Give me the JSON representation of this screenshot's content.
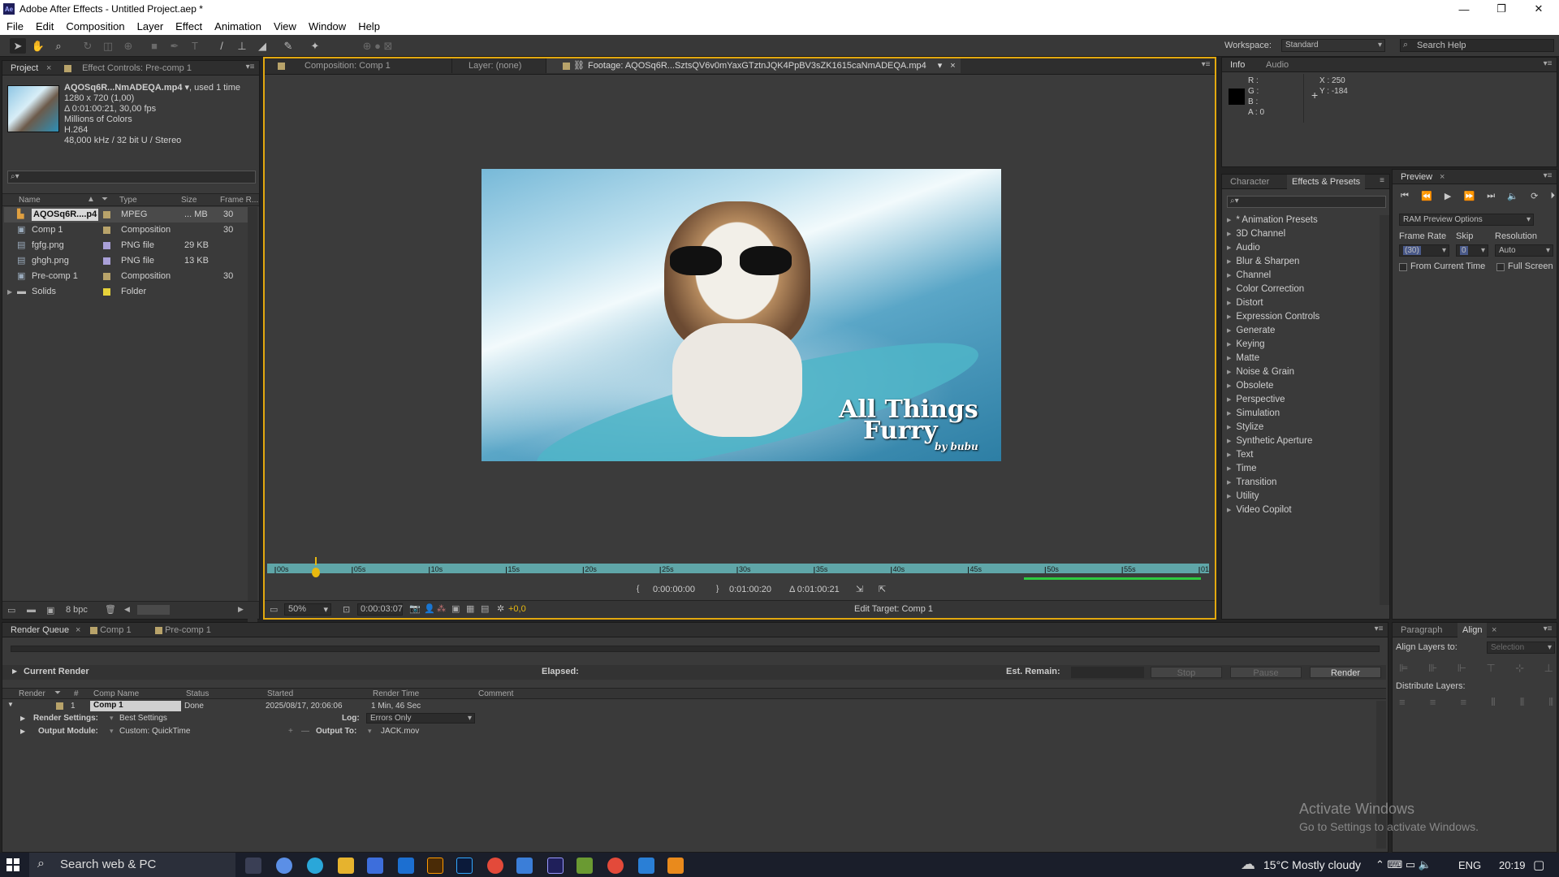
{
  "window": {
    "title": "Adobe After Effects - Untitled Project.aep *",
    "logo": "Ae",
    "minimize": "—",
    "maximize": "❐",
    "close": "✕"
  },
  "menu": [
    "File",
    "Edit",
    "Composition",
    "Layer",
    "Effect",
    "Animation",
    "View",
    "Window",
    "Help"
  ],
  "workspace": {
    "label": "Workspace:",
    "value": "Standard",
    "search_placeholder": "Search Help"
  },
  "project": {
    "tabs": [
      "Project",
      "Effect Controls: Pre-comp 1"
    ],
    "info": {
      "name": "AQOSq6R...NmADEQA.mp4 ▾",
      "used": ", used 1 time",
      "dims": "1280 x 720 (1,00)",
      "duration": "Δ 0:01:00:21, 30,00 fps",
      "colors": "Millions of Colors",
      "codec": "H.264",
      "audio": "48,000 kHz / 32 bit U / Stereo"
    },
    "search_placeholder": "⌕▾",
    "columns": [
      "Name",
      "Type",
      "Size",
      "Frame R..."
    ],
    "items": [
      {
        "name": "AQOSq6R....p4",
        "type": "MPEG",
        "size": "... MB",
        "fps": "30",
        "color": "#b8a36a",
        "icon": "footage-icon"
      },
      {
        "name": "Comp 1",
        "type": "Composition",
        "size": "",
        "fps": "30",
        "color": "#b8a36a",
        "icon": "composition-icon"
      },
      {
        "name": "fgfg.png",
        "type": "PNG file",
        "size": "29 KB",
        "fps": "",
        "color": "#a9a0d8",
        "icon": "image-icon"
      },
      {
        "name": "ghgh.png",
        "type": "PNG file",
        "size": "13 KB",
        "fps": "",
        "color": "#a9a0d8",
        "icon": "image-icon"
      },
      {
        "name": "Pre-comp 1",
        "type": "Composition",
        "size": "",
        "fps": "30",
        "color": "#b8a36a",
        "icon": "composition-icon"
      },
      {
        "name": "Solids",
        "type": "Folder",
        "size": "",
        "fps": "",
        "color": "#e6d23a",
        "icon": "folder-icon"
      }
    ],
    "bpc": "8 bpc"
  },
  "viewer": {
    "tabs": [
      "Composition: Comp 1",
      "Layer: (none)",
      "Footage: AQOSq6R...SztsQV6v0mYaxGTztnJQK4PpBV3sZK1615caNmADEQA.mp4"
    ],
    "watermark_line1": "All Things",
    "watermark_line2": "Furry",
    "watermark_line3": "by bubu",
    "ruler": [
      "00s",
      "05s",
      "10s",
      "15s",
      "20s",
      "25s",
      "30s",
      "35s",
      "40s",
      "45s",
      "50s",
      "55s",
      "01:00s"
    ],
    "in_point": "0:00:00:00",
    "out_point": "0:01:00:20",
    "duration": "Δ 0:01:00:21",
    "zoom": "50%",
    "timecode": "0:00:03:07",
    "exposure": "+0,0",
    "edit_target": "Edit Target: Comp 1"
  },
  "info": {
    "tabs": [
      "Info",
      "Audio"
    ],
    "r": "R :",
    "g": "G :",
    "b": "B :",
    "a": "A : 0",
    "x": "X : 250",
    "y": "Y : -184"
  },
  "effects": {
    "tabs": [
      "Character",
      "Effects & Presets"
    ],
    "items": [
      "* Animation Presets",
      "3D Channel",
      "Audio",
      "Blur & Sharpen",
      "Channel",
      "Color Correction",
      "Distort",
      "Expression Controls",
      "Generate",
      "Keying",
      "Matte",
      "Noise & Grain",
      "Obsolete",
      "Perspective",
      "Simulation",
      "Stylize",
      "Synthetic Aperture",
      "Text",
      "Time",
      "Transition",
      "Utility",
      "Video Copilot"
    ]
  },
  "preview": {
    "tab": "Preview",
    "ram_options": "RAM Preview Options",
    "frame_rate_label": "Frame Rate",
    "skip_label": "Skip",
    "resolution_label": "Resolution",
    "frame_rate": "(30)",
    "skip": "0",
    "resolution": "Auto",
    "from_current": "From Current Time",
    "full_screen": "Full Screen"
  },
  "align": {
    "tabs": [
      "Paragraph",
      "Align"
    ],
    "align_to_label": "Align Layers to:",
    "align_to_value": "Selection",
    "distribute_label": "Distribute Layers:"
  },
  "render_queue": {
    "tabs": [
      "Render Queue",
      "Comp 1",
      "Pre-comp 1"
    ],
    "current_render": "Current Render",
    "elapsed": "Elapsed:",
    "est_remain": "Est. Remain:",
    "stop": "Stop",
    "pause": "Pause",
    "render": "Render",
    "columns": [
      "Render",
      "#",
      "Comp Name",
      "Status",
      "Started",
      "Render Time",
      "Comment"
    ],
    "item": {
      "num": "1",
      "comp": "Comp 1",
      "status": "Done",
      "started": "2025/08/17, 20:06:06",
      "time": "1 Min, 46 Sec"
    },
    "render_settings_label": "Render Settings:",
    "render_settings": "Best Settings",
    "log_label": "Log:",
    "log": "Errors Only",
    "output_module_label": "Output Module:",
    "output_module": "Custom: QuickTime",
    "output_to_label": "Output To:",
    "output_to": "JACK.mov"
  },
  "activate": {
    "line1": "Activate Windows",
    "line2": "Go to Settings to activate Windows."
  },
  "taskbar": {
    "search": "Search web & PC",
    "weather": "15°C  Mostly cloudy",
    "lang": "ENG",
    "time": "20:19"
  }
}
